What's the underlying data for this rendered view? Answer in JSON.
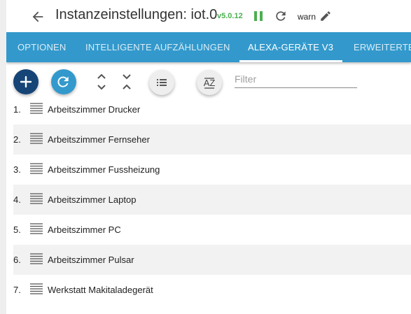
{
  "header": {
    "title": "Instanzeinstellungen: iot.0",
    "version": "v5.0.12",
    "log_level": "warn"
  },
  "tabs": [
    {
      "label": "OPTIONEN"
    },
    {
      "label": "INTELLIGENTE AUFZÄHLUNGEN"
    },
    {
      "label": "ALEXA-GERÄTE V3",
      "active": true
    },
    {
      "label": "ERWEITERTE"
    }
  ],
  "toolbar": {
    "filter_placeholder": "Filter",
    "sort_icon_text": "AZ"
  },
  "devices": [
    {
      "index": "1.",
      "name": "Arbeitszimmer Drucker"
    },
    {
      "index": "2.",
      "name": "Arbeitszimmer Fernseher"
    },
    {
      "index": "3.",
      "name": "Arbeitszimmer Fussheizung"
    },
    {
      "index": "4.",
      "name": "Arbeitszimmer Laptop"
    },
    {
      "index": "5.",
      "name": "Arbeitszimmer PC"
    },
    {
      "index": "6.",
      "name": "Arbeitszimmer Pulsar"
    },
    {
      "index": "7.",
      "name": "Werkstatt Makitaladegerät"
    }
  ],
  "colors": {
    "tab_bar": "#3399cc",
    "add_button": "#164477",
    "refresh_button": "#3399cc",
    "version_text": "#4caf50",
    "row_stripe": "#f2f2f2"
  }
}
